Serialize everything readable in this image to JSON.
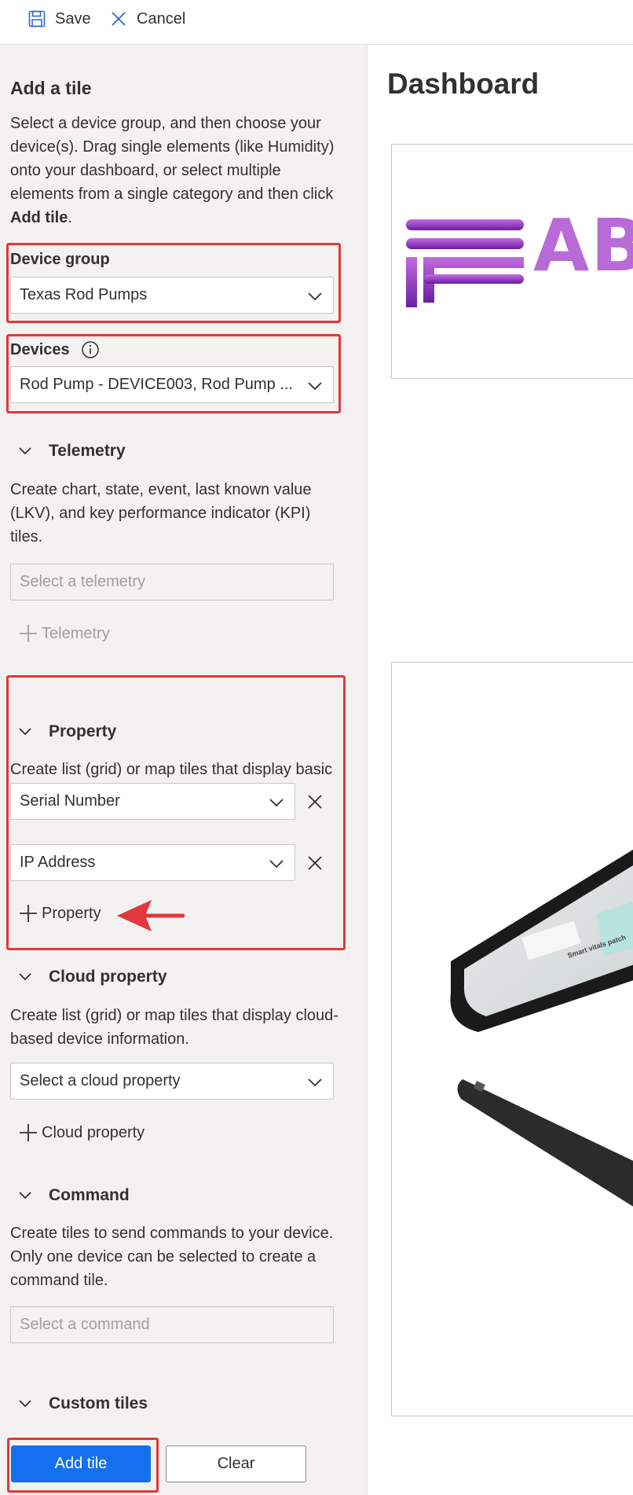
{
  "toolbar": {
    "save_label": "Save",
    "cancel_label": "Cancel",
    "save_icon": "floppy-disk-icon",
    "cancel_icon": "close-icon",
    "accent_color": "#2b6cc4"
  },
  "add_tile": {
    "title": "Add a tile",
    "intro_before": "Select a device group, and then choose your device(s). Drag single elements (like Humidity) onto your dashboard, or select multiple elements from a single category and then click ",
    "intro_bold": "Add tile",
    "intro_after": ".",
    "device_group": {
      "label": "Device group",
      "value": "Texas Rod Pumps"
    },
    "devices": {
      "label": "Devices",
      "value": "Rod Pump - DEVICE003, Rod Pump ...",
      "info_icon": "info-icon"
    },
    "telemetry": {
      "heading": "Telemetry",
      "description": "Create chart, state, event, last known value (LKV), and key performance indicator (KPI) tiles.",
      "placeholder": "Select a telemetry",
      "add_label": "Telemetry"
    },
    "property": {
      "heading": "Property",
      "description": "Create list (grid) or map tiles that display basic information about your device.",
      "selected": [
        "Serial Number",
        "IP Address"
      ],
      "add_label": "Property"
    },
    "cloud_property": {
      "heading": "Cloud property",
      "description": "Create list (grid) or map tiles that display cloud-based device information.",
      "placeholder": "Select a cloud property",
      "add_label": "Cloud property"
    },
    "command": {
      "heading": "Command",
      "description": "Create tiles to send commands to your device. Only one device can be selected to create a command tile.",
      "placeholder": "Select a command"
    },
    "custom_tiles": {
      "heading": "Custom tiles"
    },
    "add_tile_button": "Add tile",
    "clear_button": "Clear"
  },
  "dashboard": {
    "title": "Dashboard",
    "logo_text": "AB",
    "tablet_screen_text": "Smart vitals patch"
  },
  "colors": {
    "highlight": "#e0383c",
    "primary_button": "#1570ef",
    "logo_purple": "#b86bd6"
  }
}
